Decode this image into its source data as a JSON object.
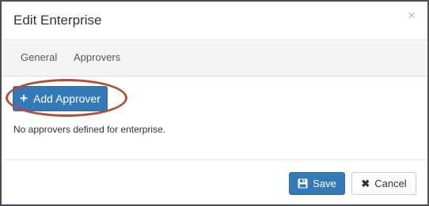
{
  "dialog": {
    "title": "Edit Enterprise",
    "close_glyph": "×"
  },
  "tabs": [
    {
      "label": "General"
    },
    {
      "label": "Approvers"
    }
  ],
  "approvers": {
    "add_button_label": "Add Approver",
    "add_button_icon": "plus-icon",
    "empty_message": "No approvers defined for enterprise."
  },
  "footer": {
    "save_label": "Save",
    "save_icon": "save-icon",
    "cancel_label": "Cancel",
    "cancel_icon": "close-icon"
  },
  "colors": {
    "primary": "#337ab7",
    "highlight_annotation": "#b54c36"
  }
}
